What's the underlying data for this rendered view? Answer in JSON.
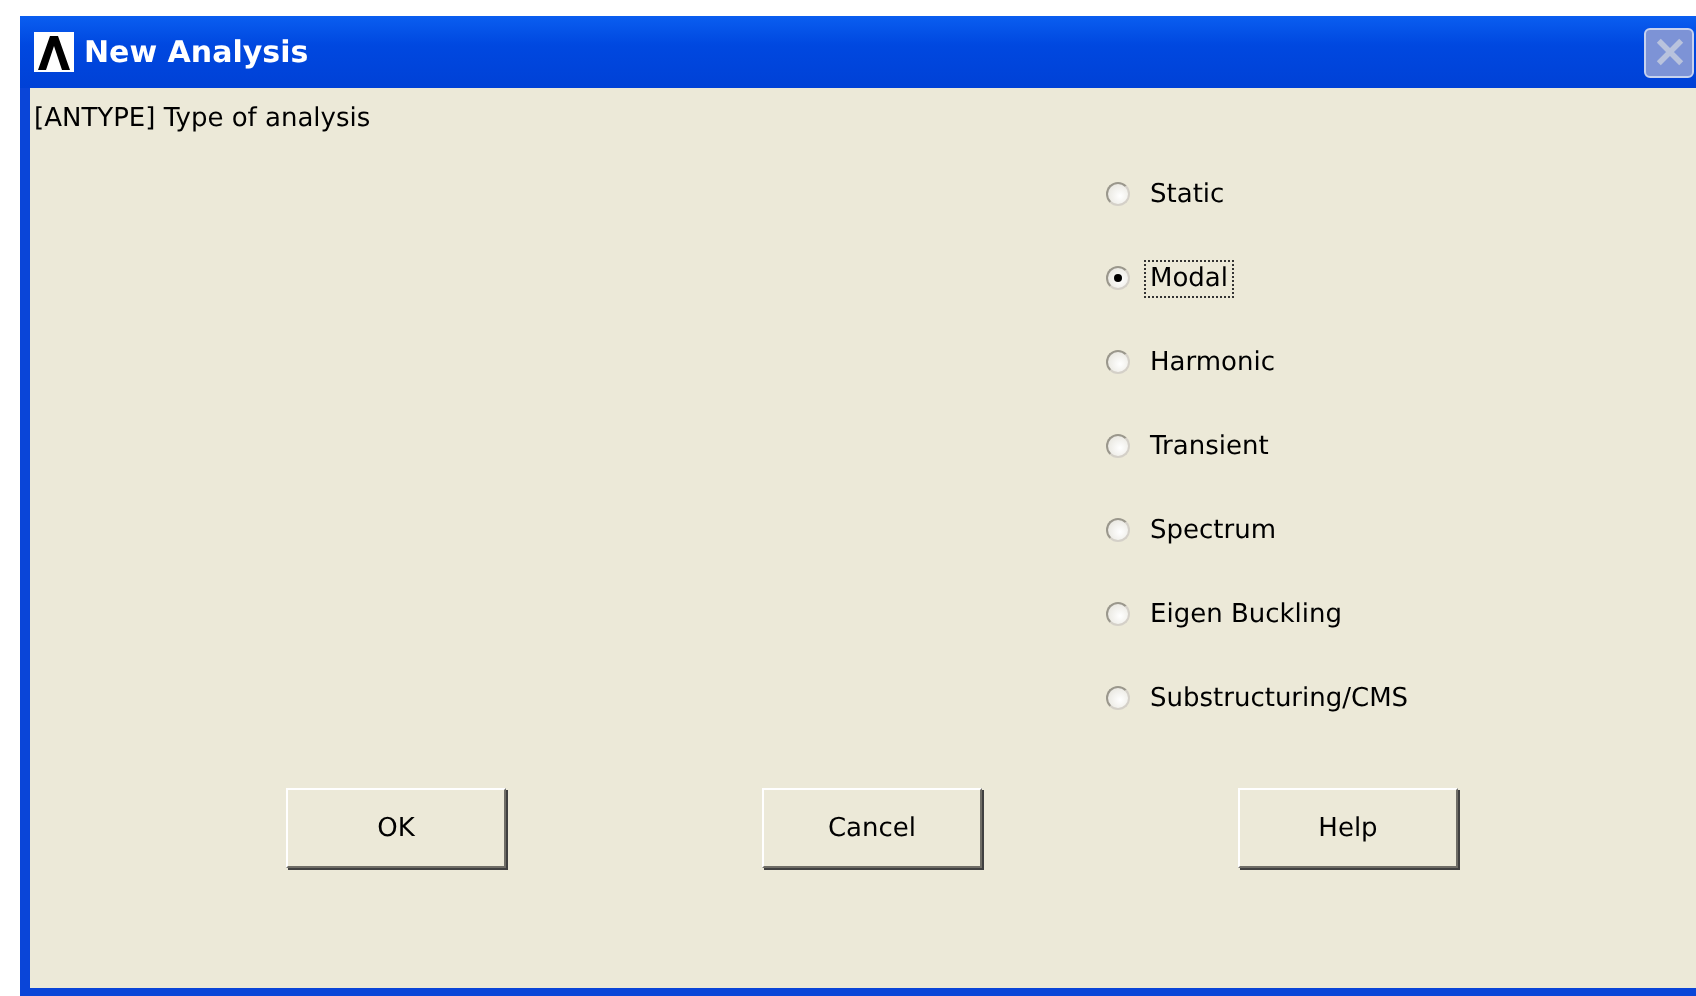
{
  "window": {
    "title": "New Analysis"
  },
  "prompt": "[ANTYPE]  Type of analysis",
  "options": [
    {
      "label": "Static",
      "selected": false
    },
    {
      "label": "Modal",
      "selected": true
    },
    {
      "label": "Harmonic",
      "selected": false
    },
    {
      "label": "Transient",
      "selected": false
    },
    {
      "label": "Spectrum",
      "selected": false
    },
    {
      "label": "Eigen Buckling",
      "selected": false
    },
    {
      "label": "Substructuring/CMS",
      "selected": false
    }
  ],
  "buttons": [
    "OK",
    "Cancel",
    "Help"
  ]
}
